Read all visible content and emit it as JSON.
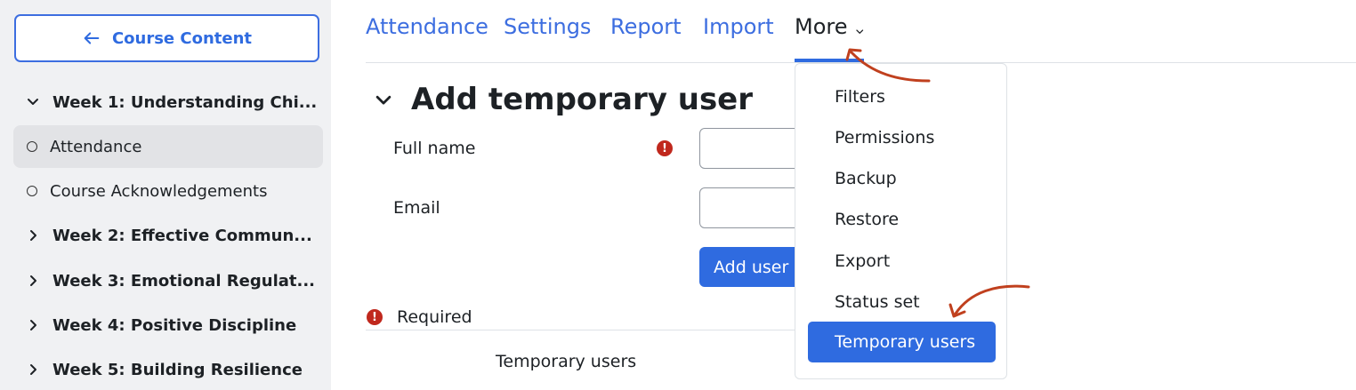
{
  "sidebar": {
    "course_button": "Course Content",
    "items": [
      {
        "label": "Week 1: Understanding Chi..."
      },
      {
        "label": "Attendance"
      },
      {
        "label": "Course Acknowledgements"
      },
      {
        "label": "Week 2: Effective Commun..."
      },
      {
        "label": "Week 3: Emotional Regulat..."
      },
      {
        "label": "Week 4: Positive Discipline"
      },
      {
        "label": "Week 5: Building Resilience"
      }
    ]
  },
  "nav": {
    "tabs": [
      "Attendance",
      "Settings",
      "Report",
      "Import"
    ],
    "more": "More"
  },
  "form": {
    "title": "Add temporary user",
    "full_name_label": "Full name",
    "email_label": "Email",
    "add_button": "Add user",
    "required_label": "Required",
    "required_icon": "!",
    "table_header": "Temporary users"
  },
  "dropdown": {
    "items": [
      "Filters",
      "Permissions",
      "Backup",
      "Restore",
      "Export",
      "Status set"
    ],
    "active": "Temporary users"
  },
  "colors": {
    "accent": "#2f6be0",
    "error": "#c0281d",
    "annotation": "#c0401e"
  }
}
